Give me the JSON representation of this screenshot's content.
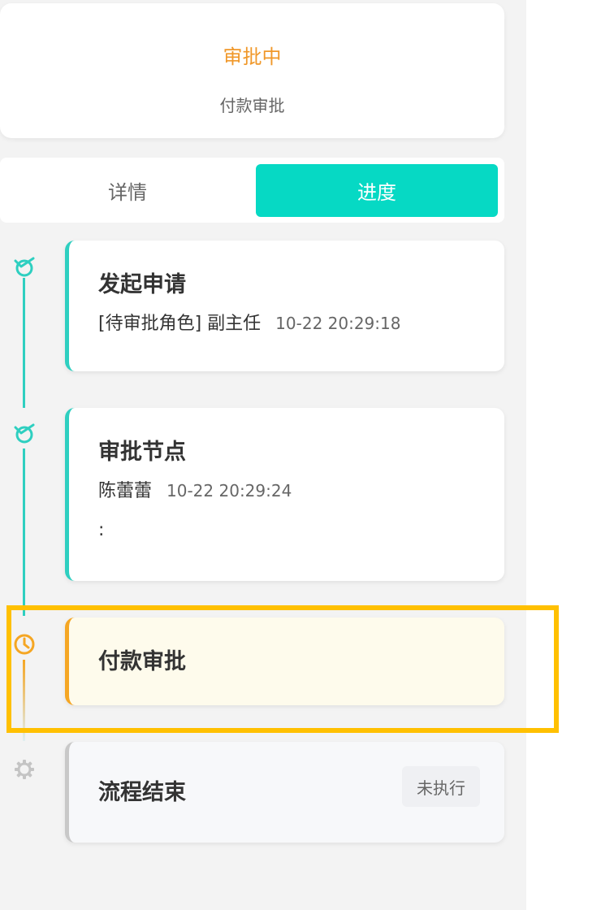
{
  "header": {
    "status": "审批中",
    "subtitle": "付款审批"
  },
  "tabs": [
    {
      "label": "详情",
      "active": false
    },
    {
      "label": "进度",
      "active": true
    }
  ],
  "steps": [
    {
      "title": "发起申请",
      "detail": "[待审批角色] 副主任",
      "time": "10-22 20:29:18",
      "state": "done",
      "icon": "check-circle-icon"
    },
    {
      "title": "审批节点",
      "detail": "陈蕾蕾",
      "time": "10-22 20:29:24",
      "comment": ":",
      "state": "done",
      "icon": "check-circle-icon"
    },
    {
      "title": "付款审批",
      "state": "in-progress",
      "icon": "clock-icon"
    },
    {
      "title": "流程结束",
      "badge": "未执行",
      "state": "not-executed",
      "icon": "gear-icon"
    }
  ],
  "colors": {
    "accent": "#06d9c4",
    "done": "#2ecfc0",
    "pending": "#f5a623",
    "status_text": "#f0982a",
    "highlight": "#ffc000"
  }
}
